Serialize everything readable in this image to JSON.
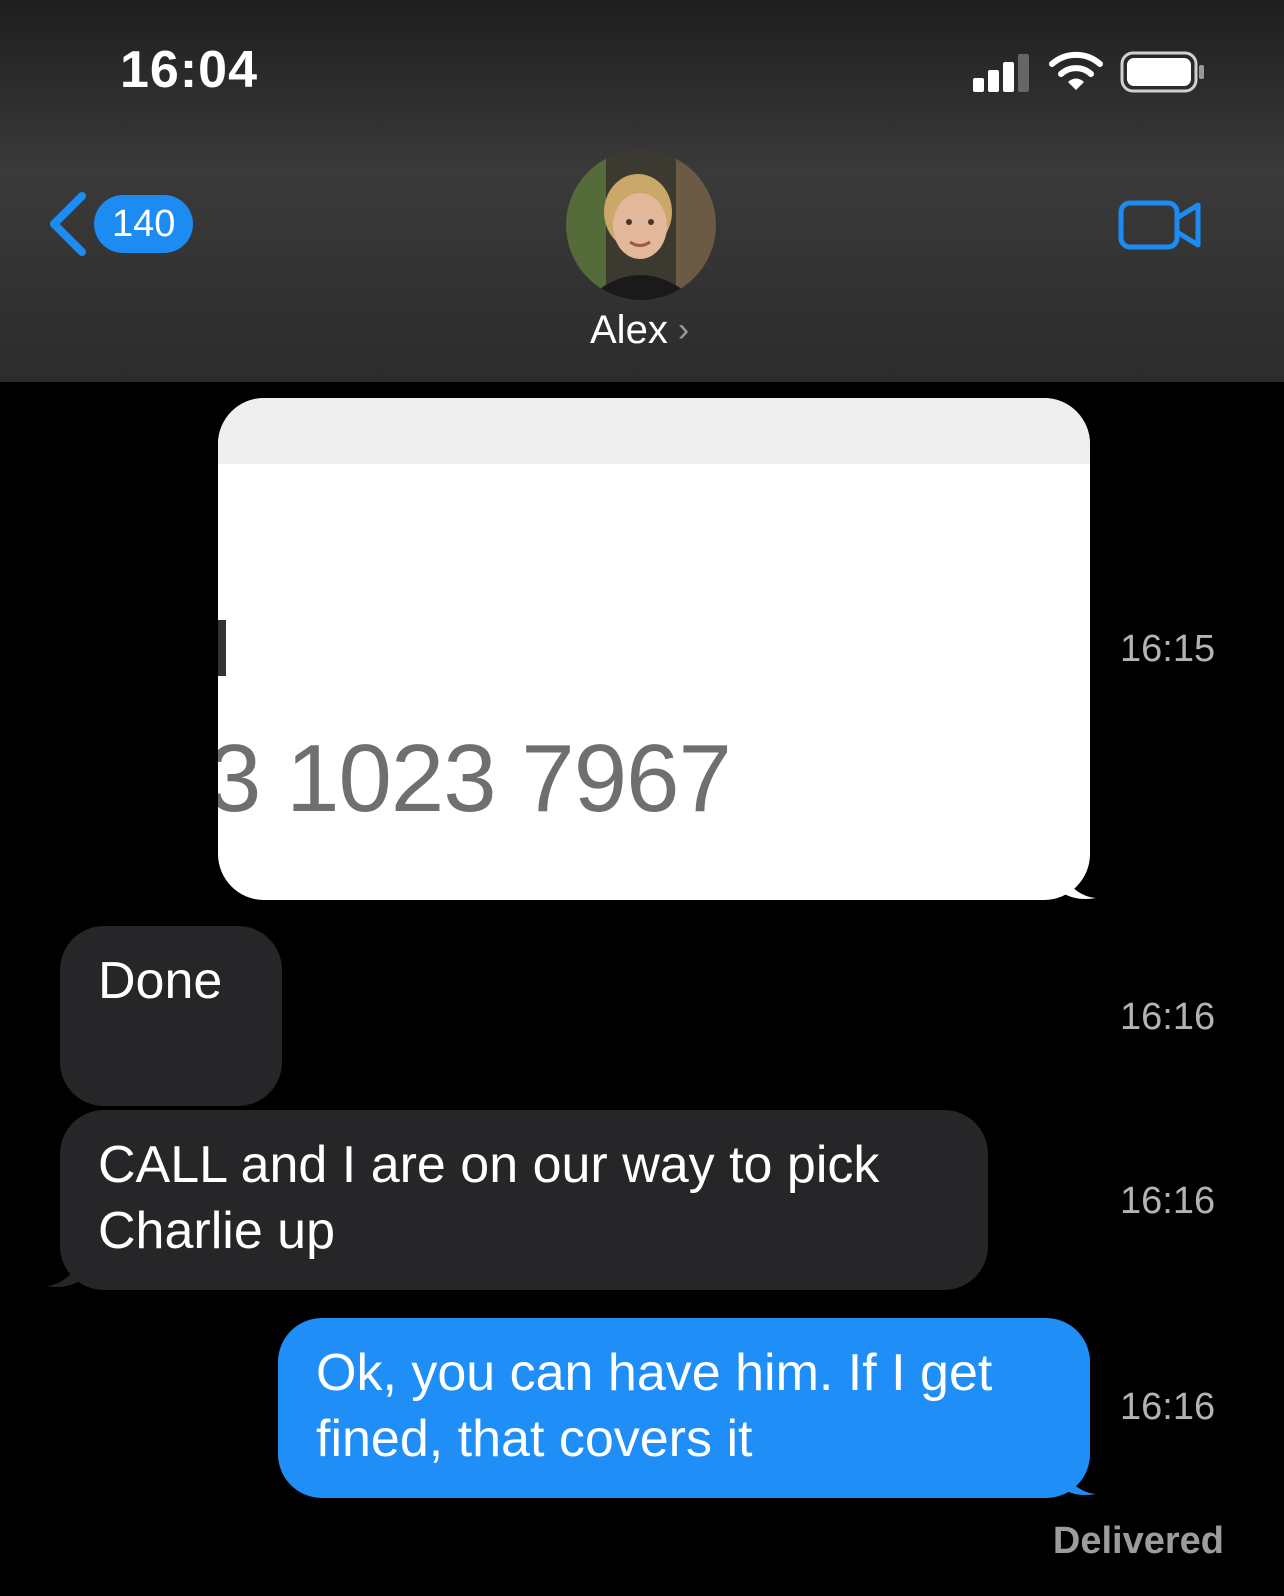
{
  "status_bar": {
    "time": "16:04"
  },
  "nav": {
    "back_count": "140",
    "contact_name": "Alex"
  },
  "messages": [
    {
      "kind": "image",
      "direction": "sent",
      "visible_text": "3 1023 7967",
      "time": "16:15"
    },
    {
      "kind": "text",
      "direction": "received",
      "text": "Done",
      "time": "16:16"
    },
    {
      "kind": "text",
      "direction": "received",
      "text": "CALL and I are on our way to pick Charlie up",
      "time": "16:16"
    },
    {
      "kind": "text",
      "direction": "sent",
      "text": "Ok, you can have him. If I get fined, that covers it",
      "time": "16:16"
    }
  ],
  "delivery_status": "Delivered",
  "colors": {
    "accent": "#1f8ef7",
    "received_bubble": "#262628",
    "background": "#000000"
  }
}
